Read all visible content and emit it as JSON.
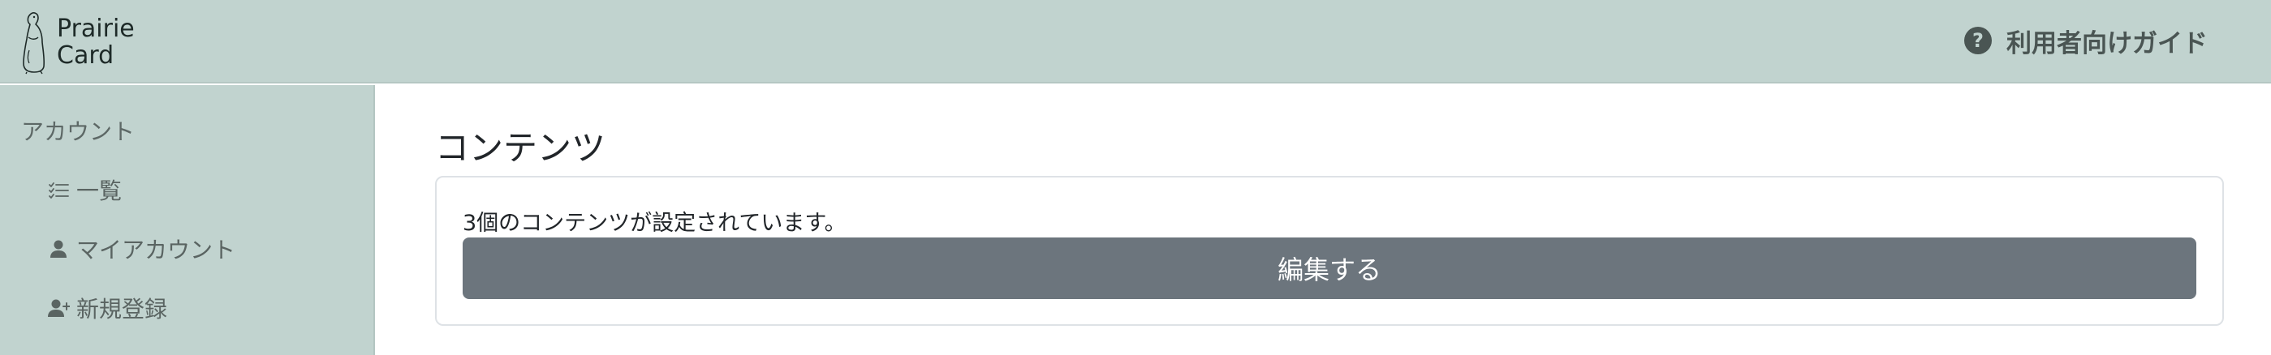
{
  "header": {
    "brand": {
      "name": "Prairie\nCard",
      "logo_icon": "prairie-dog-logo"
    },
    "guide_link": {
      "label": "利用者向けガイド",
      "icon": "question-circle-icon",
      "icon_glyph": "?"
    }
  },
  "sidebar": {
    "heading": "アカウント",
    "items": [
      {
        "label": "一覧",
        "icon": "list-check-icon"
      },
      {
        "label": "マイアカウント",
        "icon": "person-icon"
      },
      {
        "label": "新規登録",
        "icon": "person-plus-icon"
      }
    ]
  },
  "main": {
    "title": "コンテンツ",
    "card": {
      "text": "3個のコンテンツが設定されています。",
      "button_label": "編集する"
    }
  },
  "colors": {
    "sidebar_bg": "#c1d3cf",
    "header_bg": "#c1d3cf",
    "button_bg": "#6c757d",
    "text": "#212529",
    "muted_text": "#5a6462"
  }
}
